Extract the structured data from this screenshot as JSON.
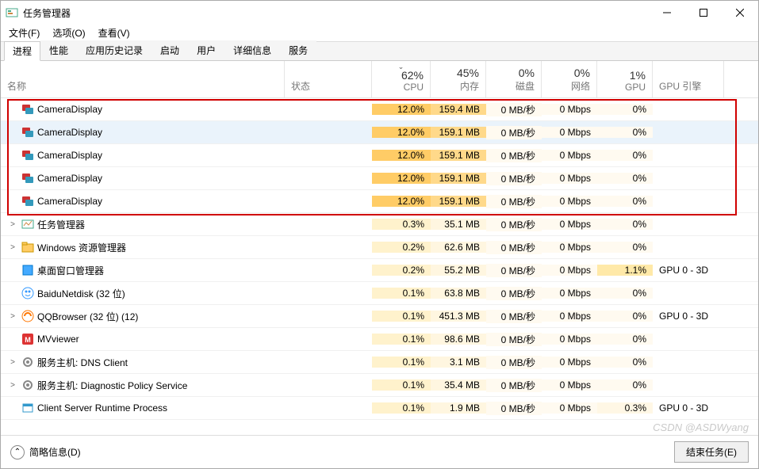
{
  "window": {
    "title": "任务管理器",
    "minimize": "—",
    "maximize": "□",
    "close": "×"
  },
  "menu": {
    "file": "文件(F)",
    "options": "选项(O)",
    "view": "查看(V)"
  },
  "tabs": {
    "processes": "进程",
    "performance": "性能",
    "app_history": "应用历史记录",
    "startup": "启动",
    "users": "用户",
    "details": "详细信息",
    "services": "服务"
  },
  "columns": {
    "name": "名称",
    "status": "状态",
    "cpu_pct": "62%",
    "cpu_lbl": "CPU",
    "mem_pct": "45%",
    "mem_lbl": "内存",
    "disk_pct": "0%",
    "disk_lbl": "磁盘",
    "net_pct": "0%",
    "net_lbl": "网络",
    "gpu_pct": "1%",
    "gpu_lbl": "GPU",
    "gpu_engine": "GPU 引擎"
  },
  "rows": [
    {
      "name": "CameraDisplay",
      "icon": "app-multi",
      "cpu": "12.0%",
      "mem": "159.4 MB",
      "disk": "0 MB/秒",
      "net": "0 Mbps",
      "gpu": "0%",
      "gpueng": "",
      "expand": "",
      "heat": "hi",
      "sel": false
    },
    {
      "name": "CameraDisplay",
      "icon": "app-multi",
      "cpu": "12.0%",
      "mem": "159.1 MB",
      "disk": "0 MB/秒",
      "net": "0 Mbps",
      "gpu": "0%",
      "gpueng": "",
      "expand": "",
      "heat": "hi",
      "sel": true
    },
    {
      "name": "CameraDisplay",
      "icon": "app-multi",
      "cpu": "12.0%",
      "mem": "159.1 MB",
      "disk": "0 MB/秒",
      "net": "0 Mbps",
      "gpu": "0%",
      "gpueng": "",
      "expand": "",
      "heat": "hi",
      "sel": false
    },
    {
      "name": "CameraDisplay",
      "icon": "app-multi",
      "cpu": "12.0%",
      "mem": "159.1 MB",
      "disk": "0 MB/秒",
      "net": "0 Mbps",
      "gpu": "0%",
      "gpueng": "",
      "expand": "",
      "heat": "hi",
      "sel": false
    },
    {
      "name": "CameraDisplay",
      "icon": "app-multi",
      "cpu": "12.0%",
      "mem": "159.1 MB",
      "disk": "0 MB/秒",
      "net": "0 Mbps",
      "gpu": "0%",
      "gpueng": "",
      "expand": "",
      "heat": "hi",
      "sel": false
    },
    {
      "name": "任务管理器",
      "icon": "taskmgr",
      "cpu": "0.3%",
      "mem": "35.1 MB",
      "disk": "0 MB/秒",
      "net": "0 Mbps",
      "gpu": "0%",
      "gpueng": "",
      "expand": ">",
      "heat": "lo",
      "sel": false
    },
    {
      "name": "Windows 资源管理器",
      "icon": "explorer",
      "cpu": "0.2%",
      "mem": "62.6 MB",
      "disk": "0 MB/秒",
      "net": "0 Mbps",
      "gpu": "0%",
      "gpueng": "",
      "expand": ">",
      "heat": "lo",
      "sel": false
    },
    {
      "name": "桌面窗口管理器",
      "icon": "dwm",
      "cpu": "0.2%",
      "mem": "55.2 MB",
      "disk": "0 MB/秒",
      "net": "0 Mbps",
      "gpu": "1.1%",
      "gpueng": "GPU 0 - 3D",
      "expand": "",
      "heat": "lo",
      "gpuhi": true,
      "sel": false
    },
    {
      "name": "BaiduNetdisk (32 位)",
      "icon": "baidu",
      "cpu": "0.1%",
      "mem": "63.8 MB",
      "disk": "0 MB/秒",
      "net": "0 Mbps",
      "gpu": "0%",
      "gpueng": "",
      "expand": "",
      "heat": "lo",
      "sel": false
    },
    {
      "name": "QQBrowser (32 位) (12)",
      "icon": "qq",
      "cpu": "0.1%",
      "mem": "451.3 MB",
      "disk": "0 MB/秒",
      "net": "0 Mbps",
      "gpu": "0%",
      "gpueng": "GPU 0 - 3D",
      "expand": ">",
      "heat": "lo",
      "sel": false
    },
    {
      "name": "MVviewer",
      "icon": "mv",
      "cpu": "0.1%",
      "mem": "98.6 MB",
      "disk": "0 MB/秒",
      "net": "0 Mbps",
      "gpu": "0%",
      "gpueng": "",
      "expand": "",
      "heat": "lo",
      "sel": false
    },
    {
      "name": "服务主机: DNS Client",
      "icon": "svc",
      "cpu": "0.1%",
      "mem": "3.1 MB",
      "disk": "0 MB/秒",
      "net": "0 Mbps",
      "gpu": "0%",
      "gpueng": "",
      "expand": ">",
      "heat": "lo",
      "sel": false
    },
    {
      "name": "服务主机: Diagnostic Policy Service",
      "icon": "svc",
      "cpu": "0.1%",
      "mem": "35.4 MB",
      "disk": "0 MB/秒",
      "net": "0 Mbps",
      "gpu": "0%",
      "gpueng": "",
      "expand": ">",
      "heat": "lo",
      "sel": false
    },
    {
      "name": "Client Server Runtime Process",
      "icon": "csrss",
      "cpu": "0.1%",
      "mem": "1.9 MB",
      "disk": "0 MB/秒",
      "net": "0 Mbps",
      "gpu": "0.3%",
      "gpueng": "GPU 0 - 3D",
      "expand": "",
      "heat": "lo",
      "gpumed": true,
      "sel": false
    }
  ],
  "footer": {
    "details_toggle": "简略信息(D)",
    "end_task": "结束任务(E)"
  },
  "watermark": "CSDN @ASDWyang"
}
